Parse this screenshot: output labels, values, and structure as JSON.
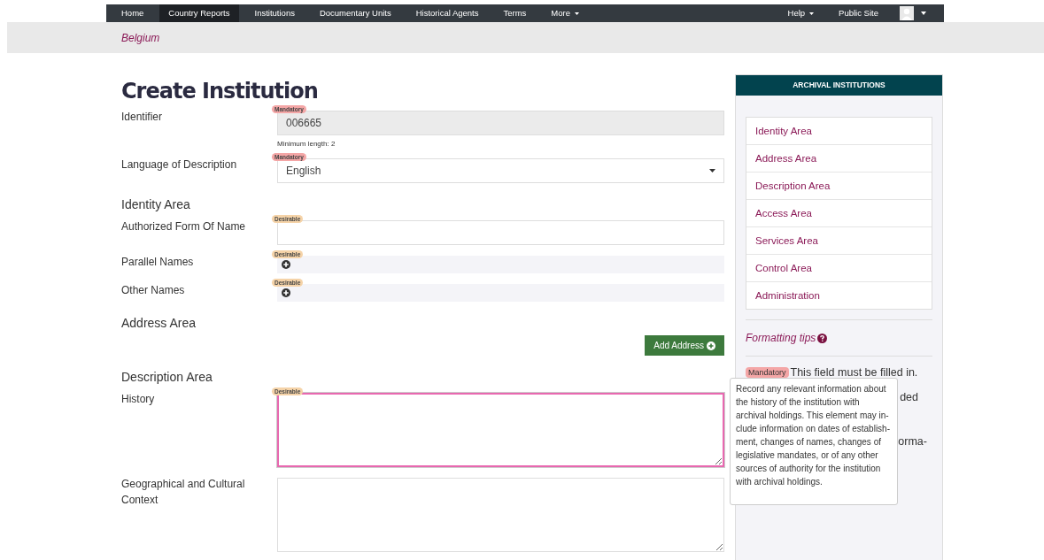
{
  "nav": {
    "items": [
      {
        "label": "Home",
        "selected": false,
        "dropdown": false
      },
      {
        "label": "Country Reports",
        "selected": true,
        "dropdown": false
      },
      {
        "label": "Institutions",
        "selected": false,
        "dropdown": false
      },
      {
        "label": "Documentary Units",
        "selected": false,
        "dropdown": false
      },
      {
        "label": "Historical Agents",
        "selected": false,
        "dropdown": false
      },
      {
        "label": "Terms",
        "selected": false,
        "dropdown": false
      },
      {
        "label": "More",
        "selected": false,
        "dropdown": true
      }
    ],
    "right": [
      {
        "label": "Help",
        "dropdown": true
      },
      {
        "label": "Public Site",
        "dropdown": false
      }
    ]
  },
  "breadcrumb": "Belgium",
  "title": "Create Institution",
  "form": [
    {
      "kind": "input",
      "label": "Identifier",
      "badge": "Mandatory",
      "value": "006665",
      "disabled": true,
      "help": "Minimum length: 2"
    },
    {
      "kind": "select",
      "label": "Language of Description",
      "badge": "Mandatory",
      "value": "English"
    },
    {
      "kind": "heading",
      "label": "Identity Area"
    },
    {
      "kind": "input",
      "label": "Authorized Form Of Name",
      "badge": "Desirable",
      "disabled": false
    },
    {
      "kind": "list",
      "label": "Parallel Names",
      "badge": "Desirable"
    },
    {
      "kind": "list",
      "label": "Other Names",
      "badge": "Desirable"
    },
    {
      "kind": "heading",
      "label": "Address Area"
    },
    {
      "kind": "button",
      "label": "Add Address"
    },
    {
      "kind": "heading",
      "label": "Description Area"
    },
    {
      "kind": "textarea",
      "label": "History",
      "badge": "Desirable",
      "focused": true
    },
    {
      "kind": "textarea",
      "label": "Geographical and Cultural Context",
      "focused": false
    }
  ],
  "sidebar": {
    "title": "ARCHIVAL INSTITUTIONS",
    "links": [
      "Identity Area",
      "Address Area",
      "Description Area",
      "Access Area",
      "Services Area",
      "Control Area",
      "Administration"
    ],
    "tips_link": "Formatting tips",
    "legend": [
      {
        "badge": "Mandatory",
        "text": "This field must be filled in."
      },
      {
        "text": "ded"
      },
      {
        "text": "orma-"
      }
    ]
  },
  "tooltip": "Record any relevant information about the history of the institution with archival holdings. This element may in-clude information on dates of establish-ment, changes of names, changes of legislative mandates, or of any other sources of authority for the institution with archival holdings."
}
